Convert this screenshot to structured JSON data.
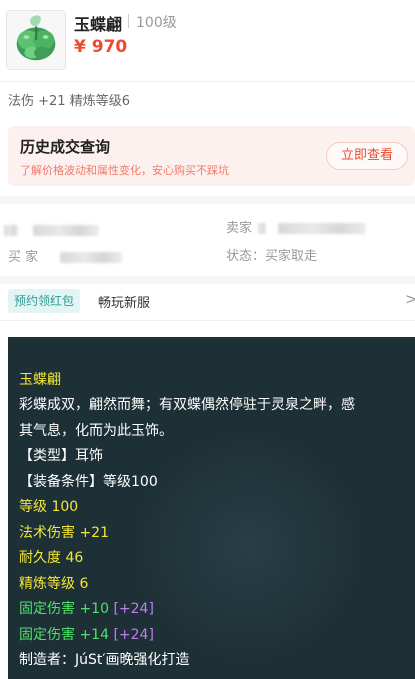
{
  "item": {
    "icon": "jade-butterfly-icon",
    "name": "玉蝶翩",
    "level": "100级",
    "price": "¥ 970",
    "attributes": "法伤 +21 精炼等级6"
  },
  "history": {
    "title": "历史成交查询",
    "subtitle": "了解价格波动和属性变化，安心购买不踩坑",
    "button": "立即查看"
  },
  "seller": {
    "seller_label": "卖家",
    "buyer_label_partial": "买 家",
    "status": "状态：买家取走"
  },
  "promo": {
    "tag": "预约领红包",
    "text": "畅玩新服",
    "arrow": ">"
  },
  "description": {
    "title": "玉蝶翩",
    "lore_line1": "彩蝶成双，翩然而舞；有双蝶偶然停驻于灵泉之畔，感",
    "lore_line2": "其气息，化而为此玉饰。",
    "type": "【类型】耳饰",
    "equip_req": "【装备条件】等级100",
    "level": "等级 100",
    "magic_damage": "法术伤害 +21",
    "durability": "耐久度 46",
    "refine": "精炼等级 6",
    "fixed1_value": "固定伤害 +10",
    "fixed1_bonus": "[+24]",
    "fixed2_value": "固定伤害 +14",
    "fixed2_bonus": "[+24]",
    "maker": "制造者：JúSt′画晚强化打造"
  },
  "colors": {
    "price": "#f04a2c",
    "panel_bg": "#1d3036",
    "yellow_text": "#f2e63a",
    "green_text": "#4fe06a",
    "purple_text": "#c07cf0"
  }
}
